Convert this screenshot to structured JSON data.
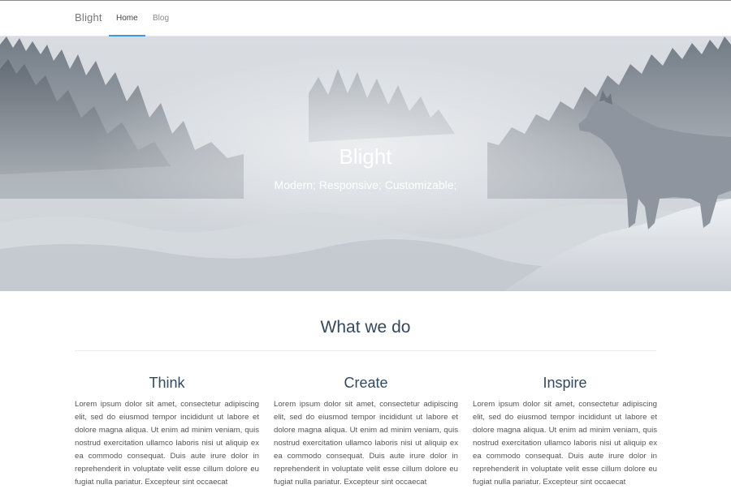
{
  "navbar": {
    "brand": "Blight",
    "links": [
      {
        "label": "Home",
        "active": true
      },
      {
        "label": "Blog",
        "active": false
      }
    ],
    "accent_color": "#3b99e0"
  },
  "hero": {
    "title": "Blight",
    "subtitle": "Modern; Responsive; Customizable;"
  },
  "section": {
    "title": "What we do",
    "columns": [
      {
        "heading": "Think",
        "text": "Lorem ipsum dolor sit amet, consectetur adipiscing elit, sed do eiusmod tempor incididunt ut labore et dolore magna aliqua. Ut enim ad minim veniam, quis nostrud exercitation ullamco laboris nisi ut aliquip ex ea commodo consequat. Duis aute irure dolor in reprehenderit in voluptate velit esse cillum dolore eu fugiat nulla pariatur. Excepteur sint occaecat"
      },
      {
        "heading": "Create",
        "text": "Lorem ipsum dolor sit amet, consectetur adipiscing elit, sed do eiusmod tempor incididunt ut labore et dolore magna aliqua. Ut enim ad minim veniam, quis nostrud exercitation ullamco laboris nisi ut aliquip ex ea commodo consequat. Duis aute irure dolor in reprehenderit in voluptate velit esse cillum dolore eu fugiat nulla pariatur. Excepteur sint occaecat"
      },
      {
        "heading": "Inspire",
        "text": "Lorem ipsum dolor sit amet, consectetur adipiscing elit, sed do eiusmod tempor incididunt ut labore et dolore magna aliqua. Ut enim ad minim veniam, quis nostrud exercitation ullamco laboris nisi ut aliquip ex ea commodo consequat. Duis aute irure dolor in reprehenderit in voluptate velit esse cillum dolore eu fugiat nulla pariatur. Excepteur sint occaecat"
      }
    ]
  }
}
